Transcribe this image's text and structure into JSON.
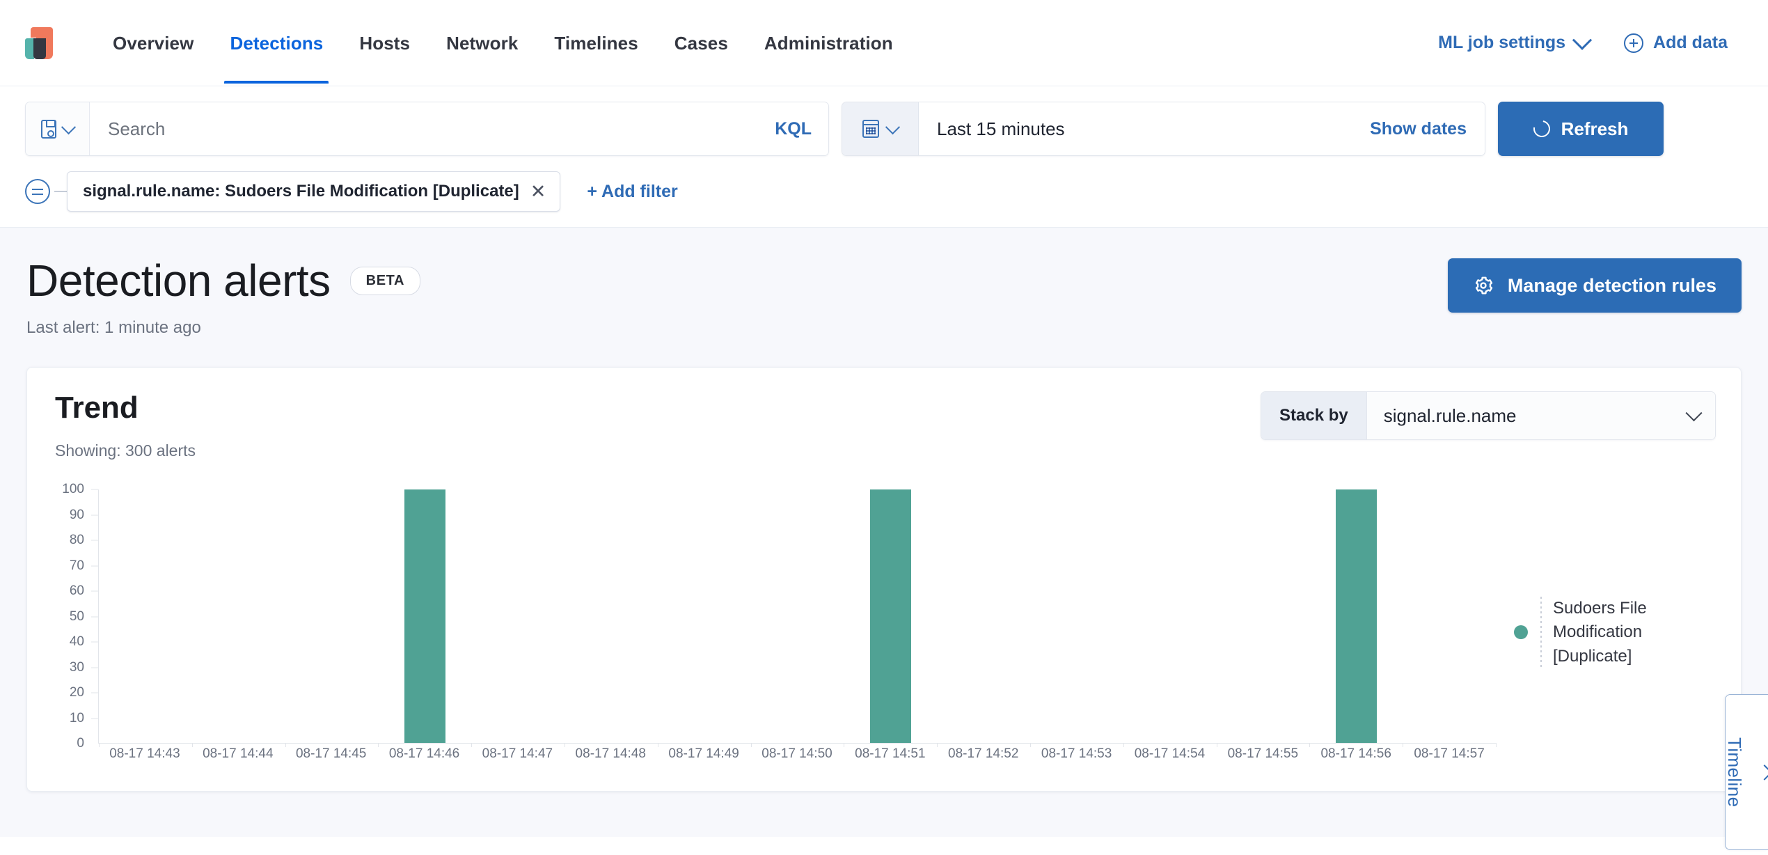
{
  "header": {
    "logo_name": "elastic-security-logo",
    "nav_items": [
      {
        "label": "Overview",
        "active": false
      },
      {
        "label": "Detections",
        "active": true
      },
      {
        "label": "Hosts",
        "active": false
      },
      {
        "label": "Network",
        "active": false
      },
      {
        "label": "Timelines",
        "active": false
      },
      {
        "label": "Cases",
        "active": false
      },
      {
        "label": "Administration",
        "active": false
      }
    ],
    "ml_job_settings": "ML job settings",
    "add_data": "Add data",
    "link_color": "#2f6bb5"
  },
  "query_bar": {
    "search_placeholder": "Search",
    "search_value": "",
    "query_language": "KQL",
    "date_range": "Last 15 minutes",
    "show_dates": "Show dates",
    "refresh": "Refresh",
    "filter_pill": "signal.rule.name: Sudoers File Modification [Duplicate]",
    "filter_remove": "✕",
    "add_filter": "+ Add filter"
  },
  "page": {
    "title": "Detection alerts",
    "badge": "BETA",
    "subtitle": "Last alert: 1 minute ago",
    "manage_rules": "Manage detection rules",
    "primary_color": "#2c6cb5"
  },
  "trend_panel": {
    "title": "Trend",
    "showing": "Showing: 300 alerts",
    "stack_by_label": "Stack by",
    "stack_by_value": "signal.rule.name"
  },
  "timeline_flyout": {
    "label": "Timeline"
  },
  "chart_data": {
    "type": "bar",
    "title": "Trend",
    "xlabel": "",
    "ylabel": "",
    "ylim": [
      0,
      100
    ],
    "yticks": [
      0,
      10,
      20,
      30,
      40,
      50,
      60,
      70,
      80,
      90,
      100
    ],
    "grid": false,
    "legend_position": "right",
    "series_color": "#50a294",
    "categories": [
      "08-17 14:43",
      "08-17 14:44",
      "08-17 14:45",
      "08-17 14:46",
      "08-17 14:47",
      "08-17 14:48",
      "08-17 14:49",
      "08-17 14:50",
      "08-17 14:51",
      "08-17 14:52",
      "08-17 14:53",
      "08-17 14:54",
      "08-17 14:55",
      "08-17 14:56",
      "08-17 14:57"
    ],
    "series": [
      {
        "name": "Sudoers File Modification [Duplicate]",
        "values": [
          0,
          0,
          0,
          100,
          0,
          0,
          0,
          0,
          100,
          0,
          0,
          0,
          0,
          100,
          0
        ]
      }
    ]
  }
}
